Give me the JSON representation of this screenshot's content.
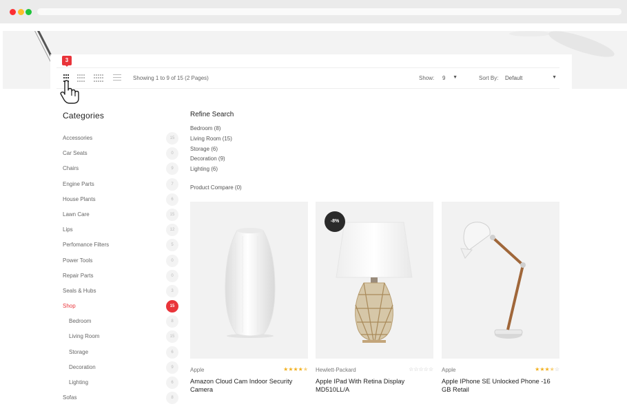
{
  "toolbar": {
    "compare_badge": "3",
    "showing": "Showing 1 to 9 of 15 (2 Pages)",
    "show_label": "Show:",
    "show_value": "9",
    "sort_label": "Sort By:",
    "sort_value": "Default"
  },
  "sidebar": {
    "title": "Categories",
    "items": [
      {
        "label": "Accessories",
        "count": "15"
      },
      {
        "label": "Car Seats",
        "count": "0"
      },
      {
        "label": "Chairs",
        "count": "9"
      },
      {
        "label": "Engine Parts",
        "count": "7"
      },
      {
        "label": "House Plants",
        "count": "6"
      },
      {
        "label": "Lawn Care",
        "count": "15"
      },
      {
        "label": "Lips",
        "count": "12"
      },
      {
        "label": "Perfomance Filters",
        "count": "5"
      },
      {
        "label": "Power Tools",
        "count": "0"
      },
      {
        "label": "Repair Parts",
        "count": "0"
      },
      {
        "label": "Seals & Hubs",
        "count": "3"
      },
      {
        "label": "Shop",
        "count": "15"
      },
      {
        "label": "Bedroom",
        "count": "8"
      },
      {
        "label": "Living Room",
        "count": "15"
      },
      {
        "label": "Storage",
        "count": "6"
      },
      {
        "label": "Decoration",
        "count": "9"
      },
      {
        "label": "Lighting",
        "count": "6"
      },
      {
        "label": "Sofas",
        "count": "8"
      }
    ]
  },
  "refine": {
    "title": "Refine Search",
    "items": [
      "Bedroom (8)",
      "Living Room (15)",
      "Storage (6)",
      "Decoration (9)",
      "Lighting (6)"
    ],
    "compare": "Product Compare (0)"
  },
  "products": [
    {
      "brand": "Apple",
      "name": "Amazon Cloud Cam Indoor Security Camera",
      "rating": 4.5,
      "image": "white-vase"
    },
    {
      "brand": "Hewlett-Packard",
      "name": "Apple IPad With Retina Display MD510LL/A",
      "rating": 0,
      "badge": "-8%",
      "image": "table-lamp"
    },
    {
      "brand": "Apple",
      "name": "Apple IPhone SE Unlocked Phone -16 GB Retail",
      "rating": 3.5,
      "image": "desk-lamp"
    }
  ],
  "colors": {
    "accent": "#e9343a",
    "star": "#f2b01e"
  }
}
